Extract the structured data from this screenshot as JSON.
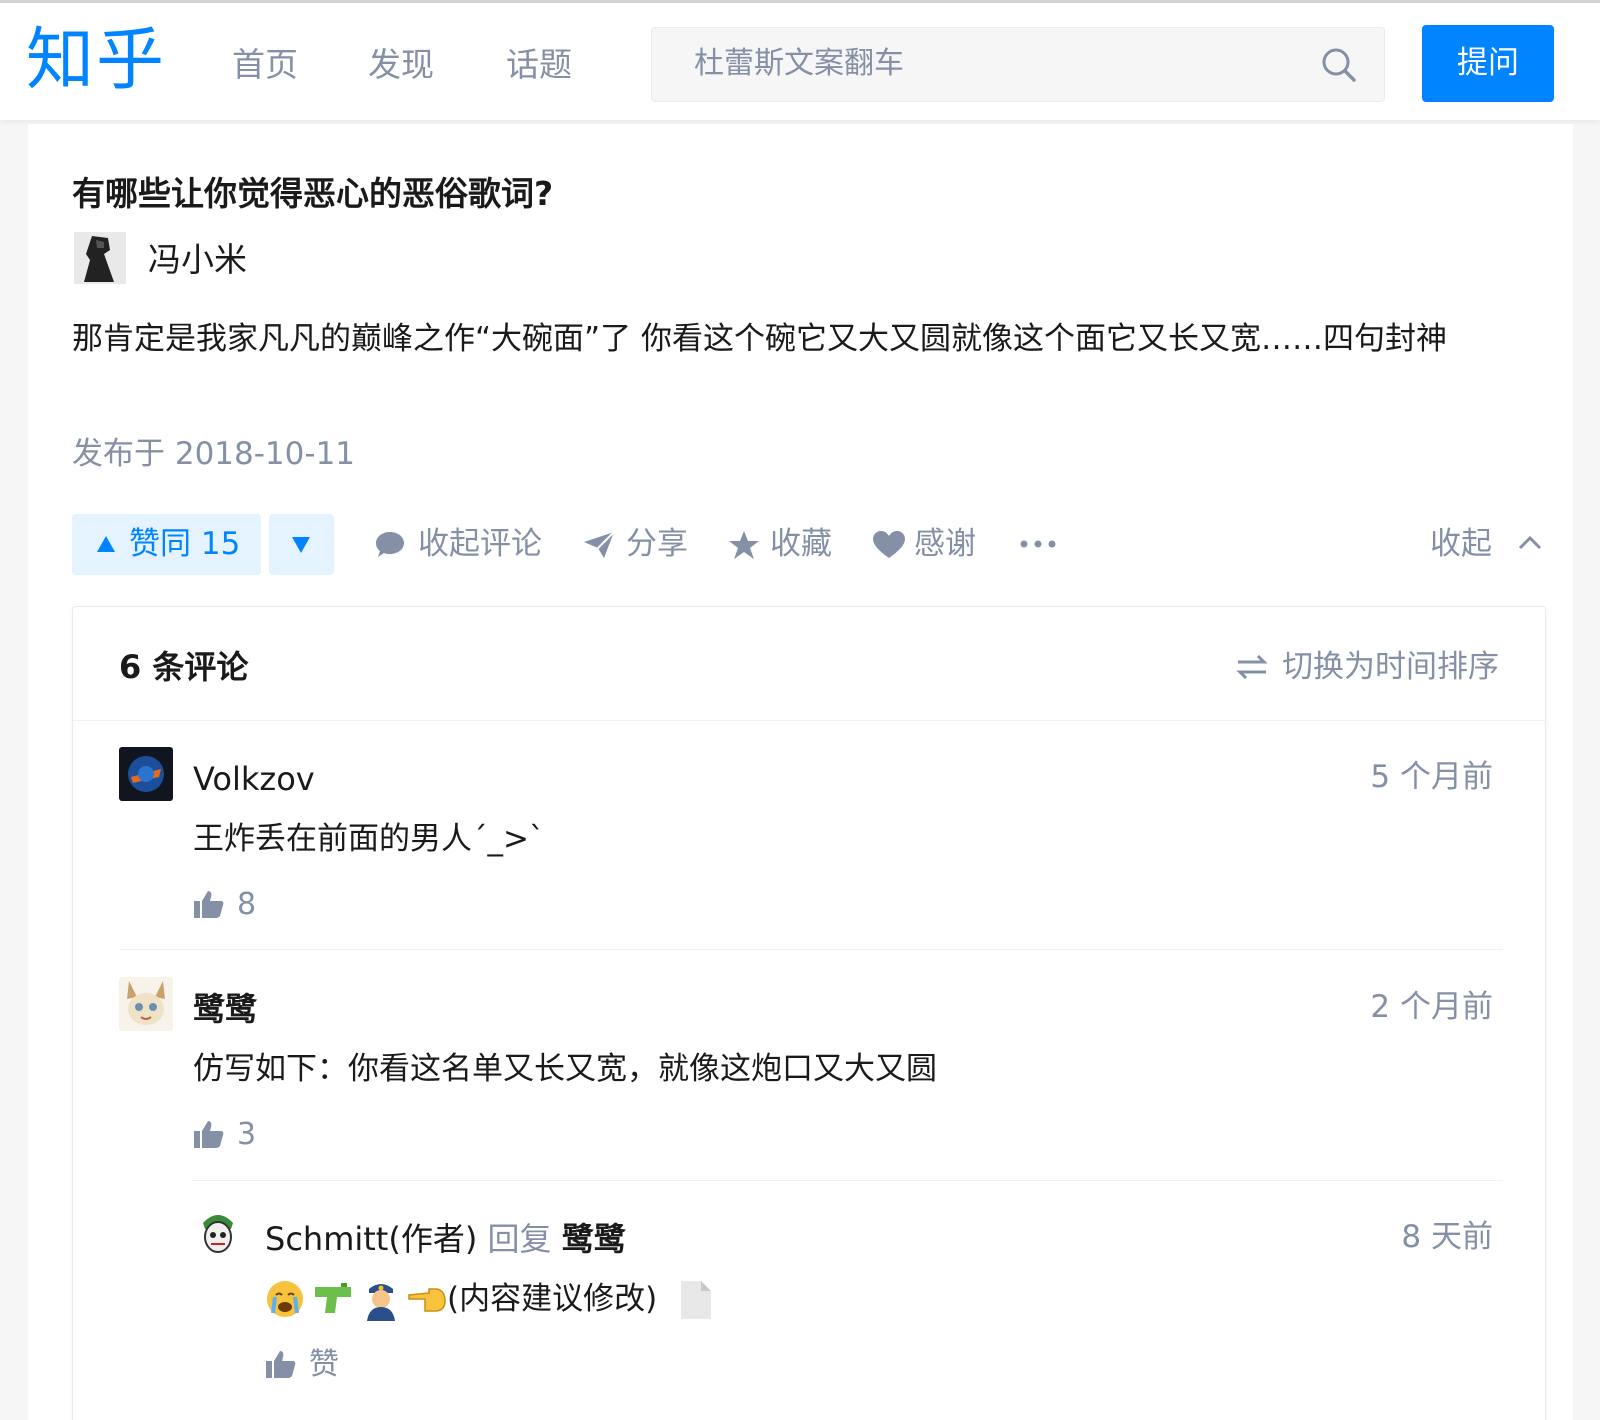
{
  "header": {
    "logo": "知乎",
    "nav": [
      "首页",
      "发现",
      "话题"
    ],
    "search_placeholder": "杜蕾斯文案翻车",
    "ask_label": "提问",
    "brand_color": "#0084ff"
  },
  "question": {
    "title": "有哪些让你觉得恶心的恶俗歌词?",
    "author": "冯小米",
    "answer_text": "那肯定是我家凡凡的巅峰之作“大碗面”了 你看这个碗它又大又圆就像这个面它又长又宽……四句封神",
    "published": "发布于 2018-10-11"
  },
  "actions": {
    "vote_up": "赞同 15",
    "collapse_comments": "收起评论",
    "share": "分享",
    "favorite": "收藏",
    "thanks": "感谢",
    "collapse": "收起"
  },
  "comments": {
    "count_label": "6 条评论",
    "sort_label": "切换为时间排序",
    "items": [
      {
        "name": "Volkzov",
        "time": "5 个月前",
        "text": "王炸丢在前面的男人´_>`",
        "likes": "8"
      },
      {
        "name": "鹭鹭",
        "time": "2 个月前",
        "text": "仿写如下：你看这名单又长又宽，就像这炮口又大又圆",
        "likes": "3"
      },
      {
        "name": "Schmitt(作者)",
        "reply_word": "回复",
        "reply_to": "鹭鹭",
        "time": "8 天前",
        "text": "(内容建议修改)",
        "emojis": [
          "crying-face",
          "water-pistol",
          "police-officer",
          "backhand-pointing-left",
          "page"
        ],
        "like_label": "赞"
      }
    ]
  }
}
